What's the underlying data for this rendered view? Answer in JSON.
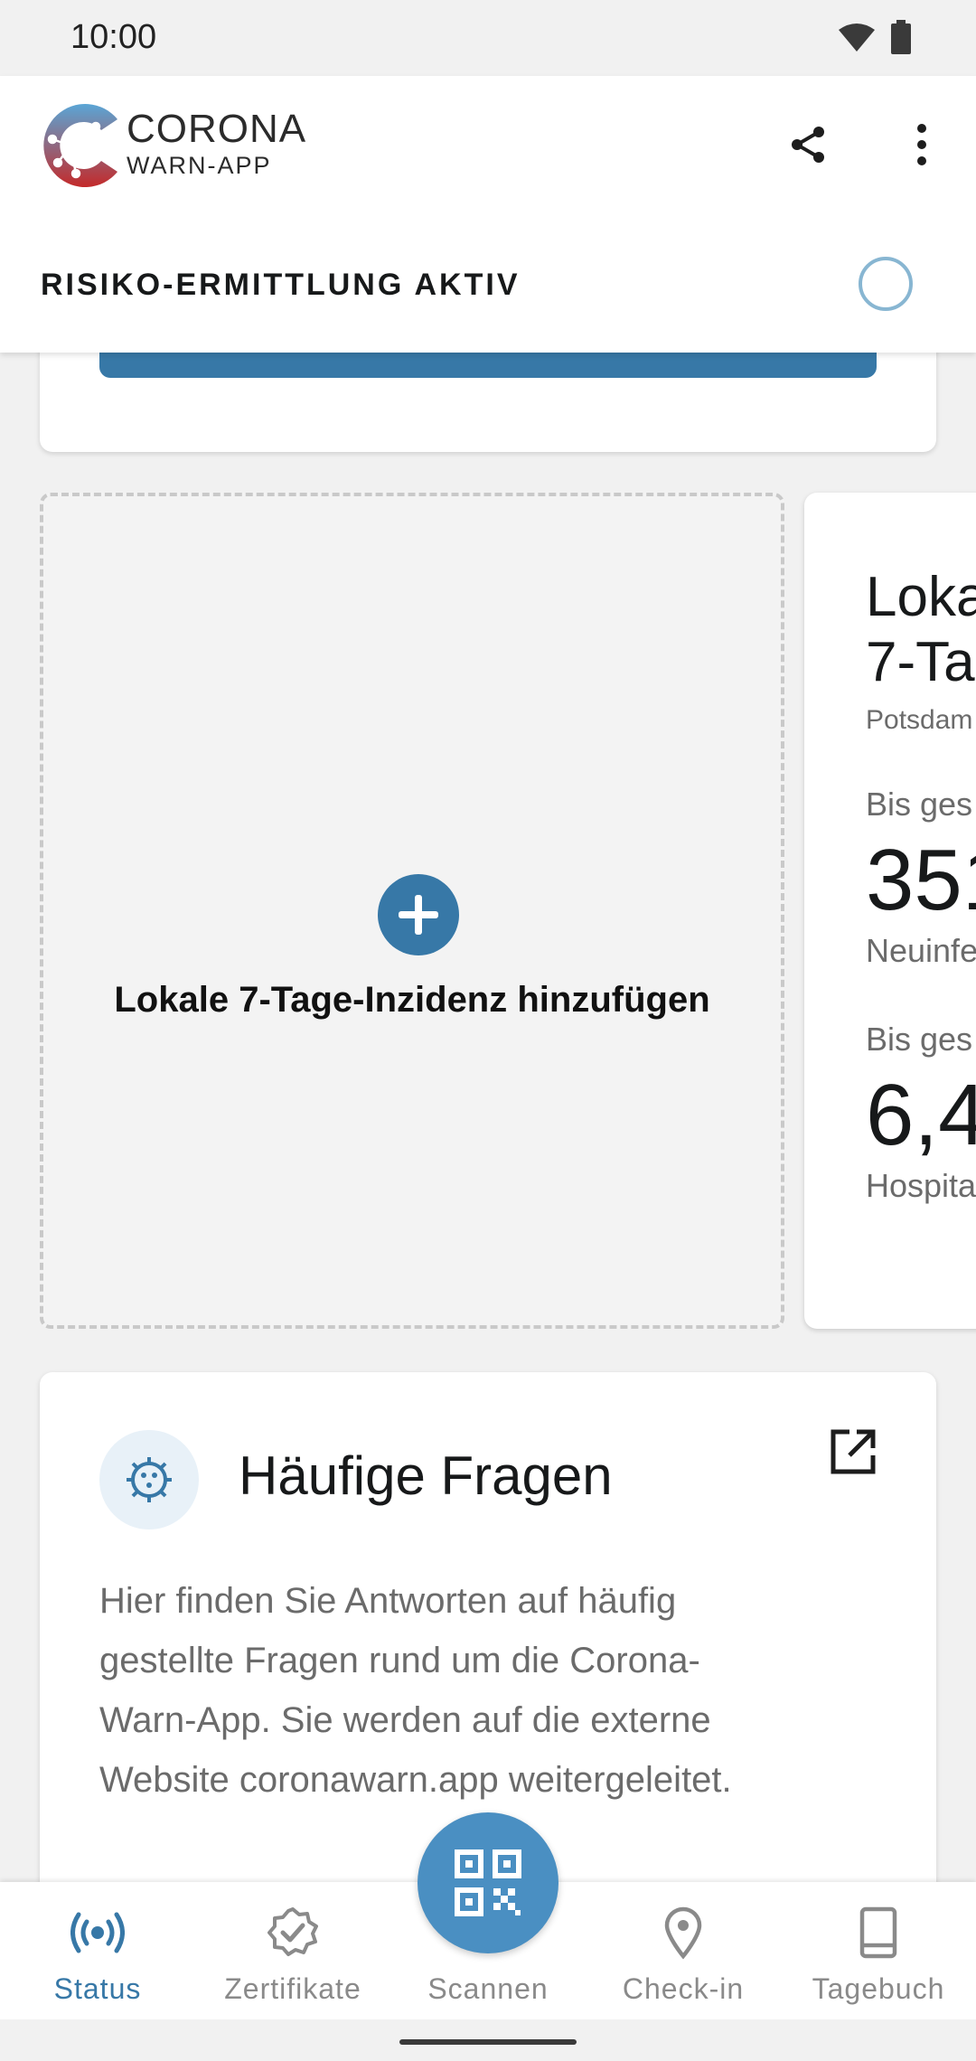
{
  "status_bar": {
    "time": "10:00"
  },
  "header": {
    "brand_line1": "CORONA",
    "brand_line2": "WARN-APP",
    "risk_status": "RISIKO-ERMITTLUNG AKTIV"
  },
  "cards": {
    "add_incidence": {
      "label": "Lokale 7-Tage-Inzidenz hinzufügen"
    },
    "incidence": {
      "title_line1": "Loka",
      "title_line2": "7-Ta",
      "subtitle": "Potsdam",
      "label1": "Bis ges",
      "value1": "351",
      "desc1": "Neuinfe",
      "label2": "Bis ges",
      "value2": "6,4",
      "desc2": "Hospita"
    },
    "faq": {
      "title": "Häufige Fragen",
      "text": "Hier finden Sie Antworten auf häufig gestellte Fragen rund um die Corona-Warn-App. Sie werden auf die externe Website coronawarn.app weitergeleitet."
    }
  },
  "bottom_nav": {
    "items": [
      {
        "label": "Status",
        "icon": "broadcast-icon",
        "active": true
      },
      {
        "label": "Zertifikate",
        "icon": "certificate-icon",
        "active": false
      },
      {
        "label": "Scannen",
        "icon": "qr-code-icon",
        "active": false
      },
      {
        "label": "Check-in",
        "icon": "location-pin-icon",
        "active": false
      },
      {
        "label": "Tagebuch",
        "icon": "book-icon",
        "active": false
      }
    ]
  },
  "colors": {
    "accent": "#3778a7",
    "fab": "#4a8fc2",
    "text_secondary": "#6b6b6b"
  }
}
